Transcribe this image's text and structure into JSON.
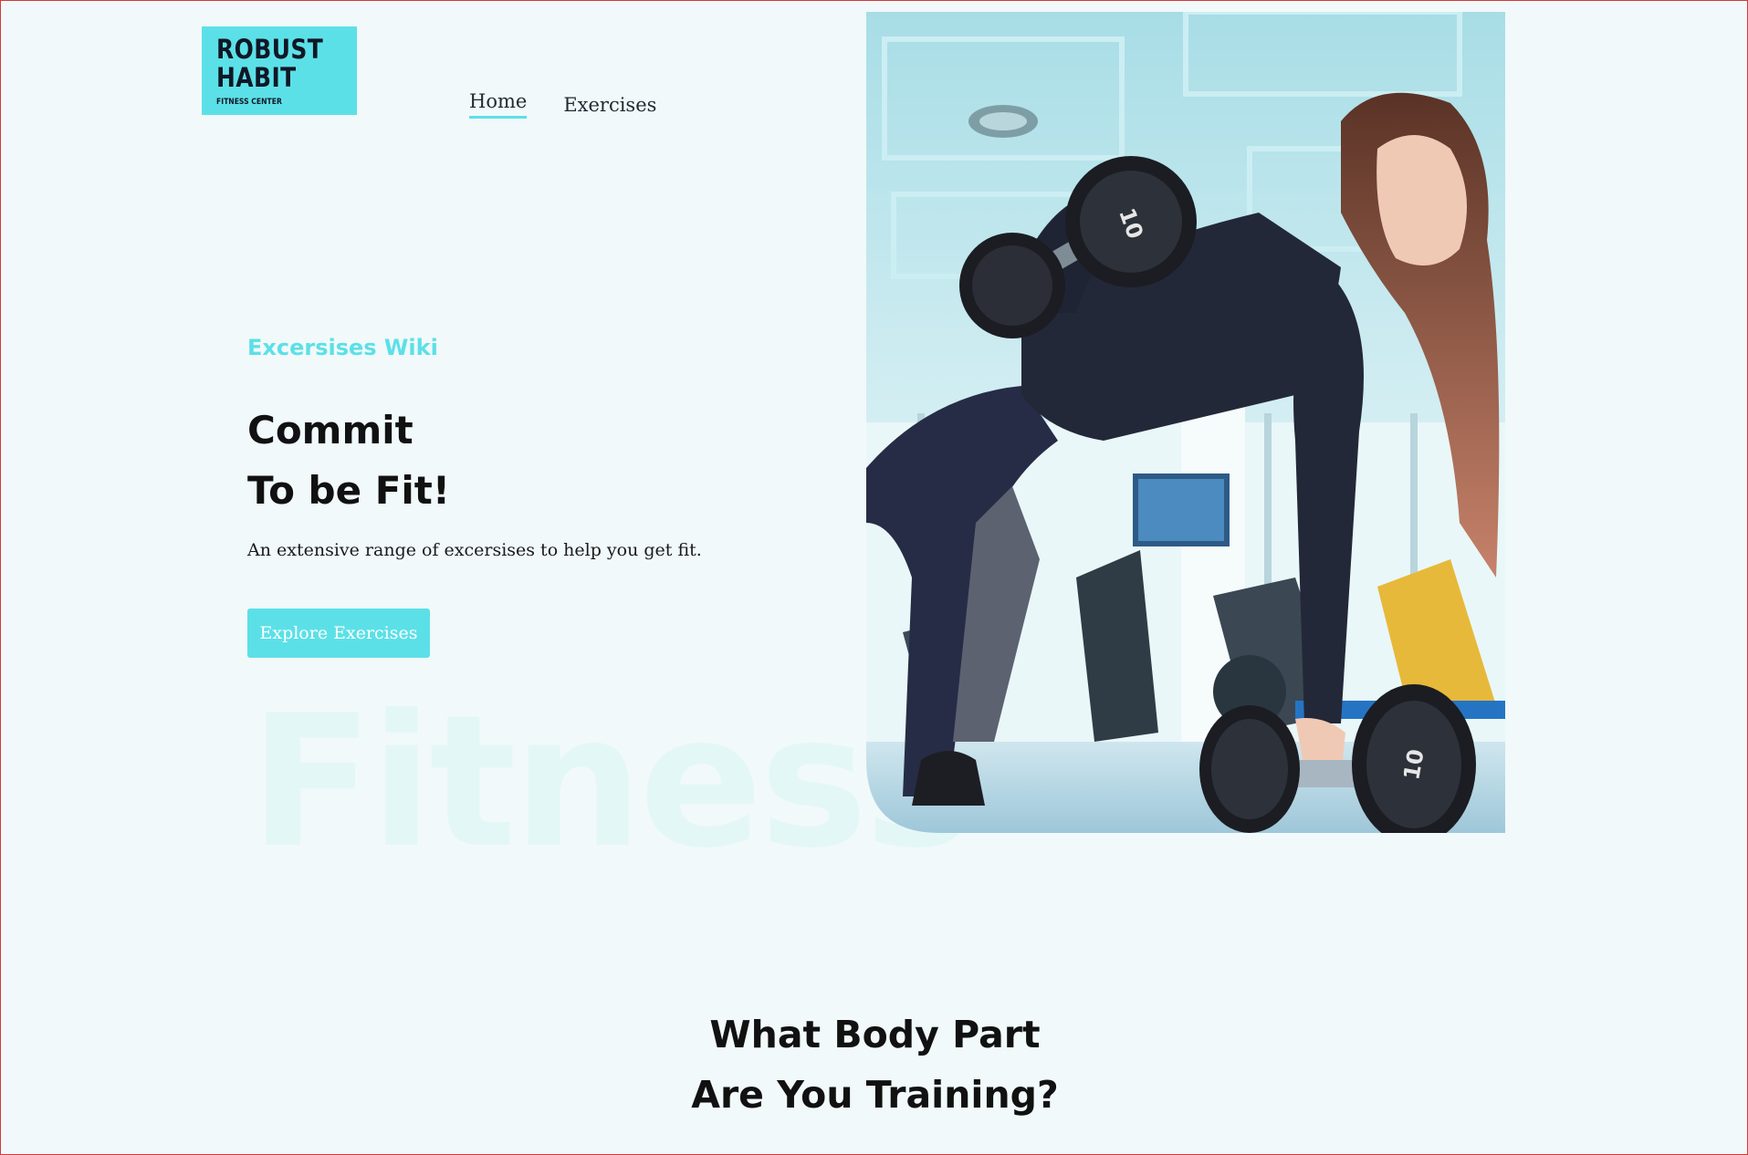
{
  "logo": {
    "line1": "ROBUST",
    "line2": "HABIT",
    "subtitle": "FITNESS CENTER"
  },
  "nav": {
    "items": [
      {
        "label": "Home",
        "active": true
      },
      {
        "label": "Exercises",
        "active": false
      }
    ]
  },
  "hero": {
    "eyebrow": "Excersises Wiki",
    "title_line1": "Commit",
    "title_line2": "To be Fit!",
    "description": "An extensive range of excersises to help you get fit.",
    "button_label": "Explore Exercises",
    "background_word": "Fitness",
    "image_alt": "Woman doing dumbbell row in gym"
  },
  "section": {
    "title_line1": "What Body Part",
    "title_line2": "Are You Training?"
  },
  "dumbbell_label": "10",
  "colors": {
    "accent": "#5ce0e7",
    "page_background": "#f1f9fa",
    "text_dark": "#111111",
    "watermark": "#e4f7f7"
  }
}
